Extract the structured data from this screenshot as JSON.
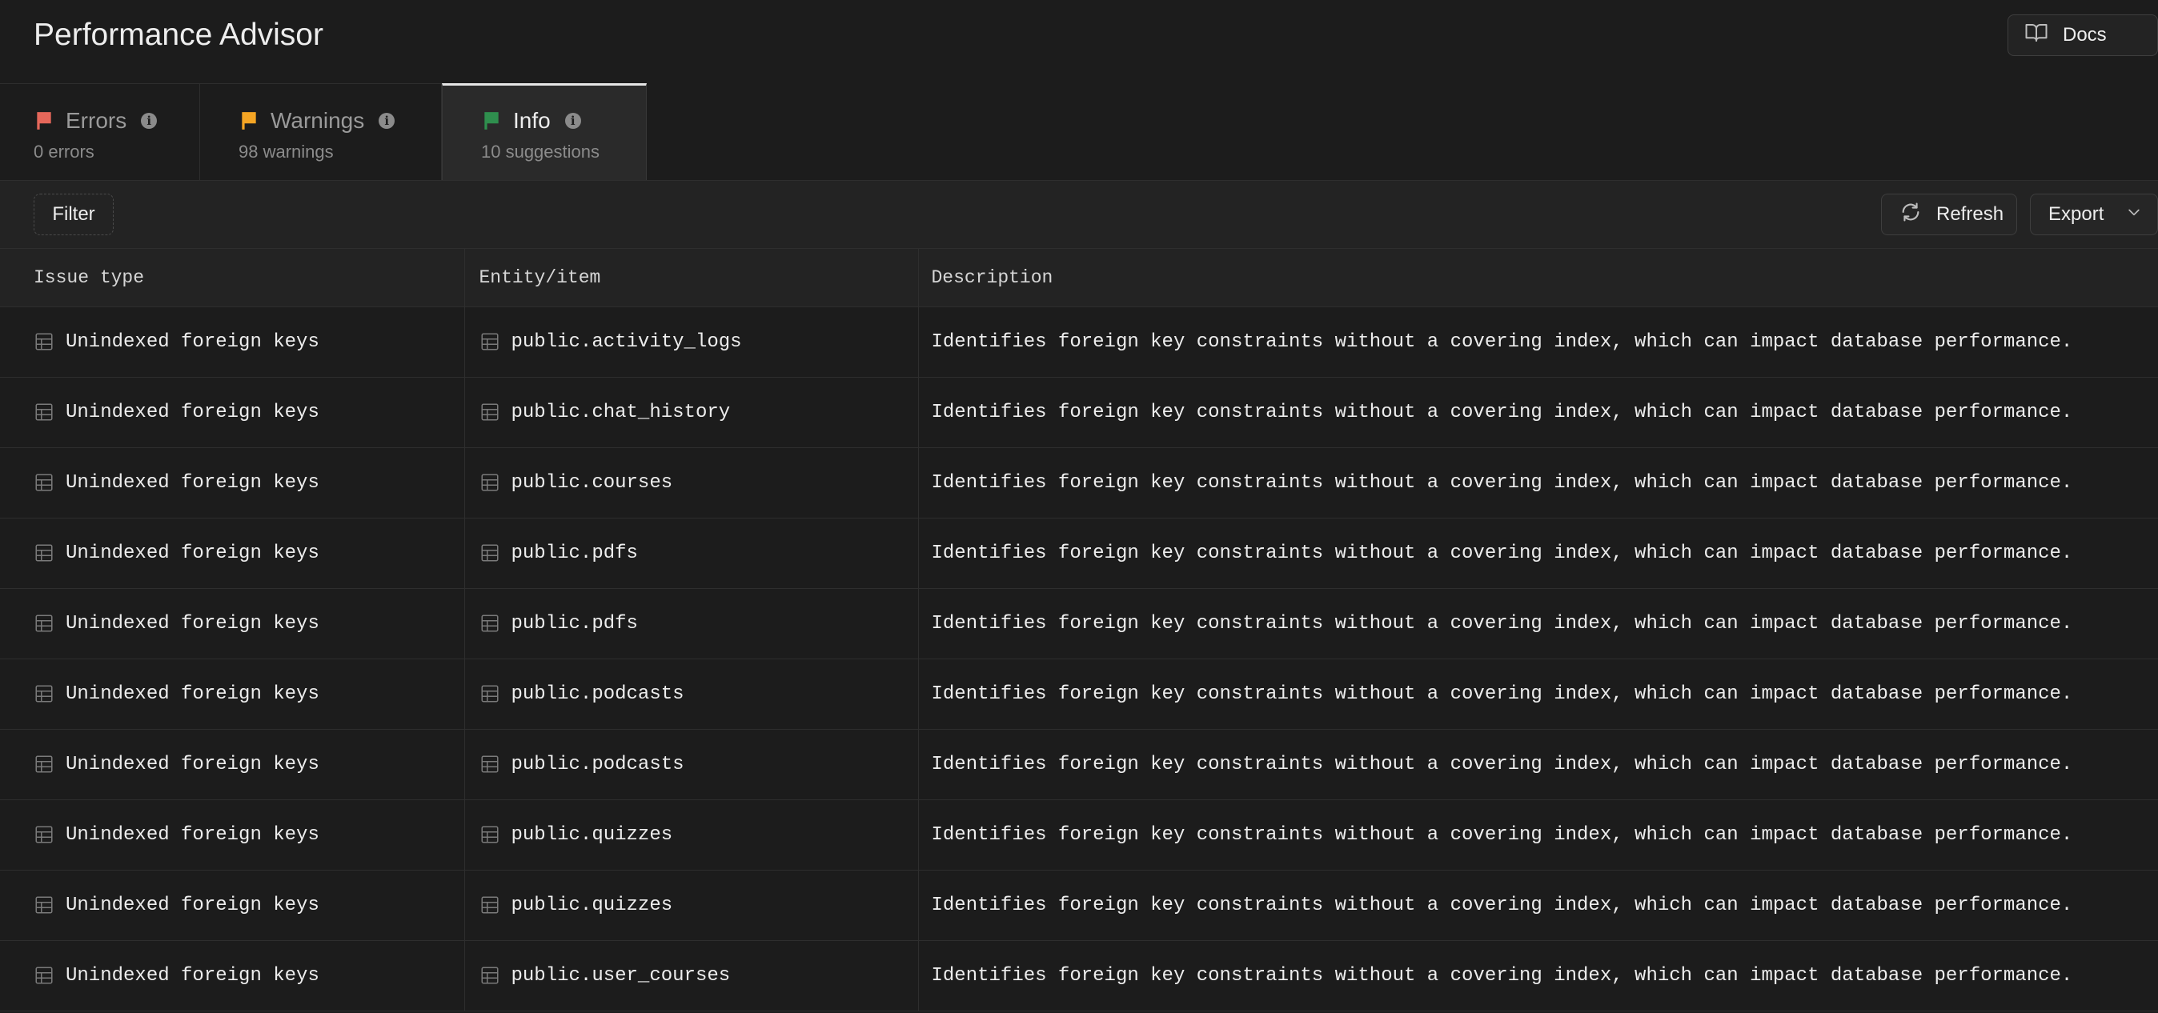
{
  "header": {
    "title": "Performance Advisor",
    "docs_label": "Docs"
  },
  "tabs": [
    {
      "label": "Errors",
      "count": "0 errors",
      "flag_color": "#e5675a"
    },
    {
      "label": "Warnings",
      "count": "98 warnings",
      "flag_color": "#f5a524"
    },
    {
      "label": "Info",
      "count": "10 suggestions",
      "flag_color": "#2f8f4e"
    }
  ],
  "toolbar": {
    "filter_label": "Filter",
    "refresh_label": "Refresh",
    "export_label": "Export"
  },
  "table": {
    "columns": [
      "Issue type",
      "Entity/item",
      "Description"
    ],
    "rows": [
      {
        "issue": "Unindexed foreign keys",
        "entity": "public.activity_logs",
        "description": "Identifies foreign key constraints without a covering index, which can impact database performance."
      },
      {
        "issue": "Unindexed foreign keys",
        "entity": "public.chat_history",
        "description": "Identifies foreign key constraints without a covering index, which can impact database performance."
      },
      {
        "issue": "Unindexed foreign keys",
        "entity": "public.courses",
        "description": "Identifies foreign key constraints without a covering index, which can impact database performance."
      },
      {
        "issue": "Unindexed foreign keys",
        "entity": "public.pdfs",
        "description": "Identifies foreign key constraints without a covering index, which can impact database performance."
      },
      {
        "issue": "Unindexed foreign keys",
        "entity": "public.pdfs",
        "description": "Identifies foreign key constraints without a covering index, which can impact database performance."
      },
      {
        "issue": "Unindexed foreign keys",
        "entity": "public.podcasts",
        "description": "Identifies foreign key constraints without a covering index, which can impact database performance."
      },
      {
        "issue": "Unindexed foreign keys",
        "entity": "public.podcasts",
        "description": "Identifies foreign key constraints without a covering index, which can impact database performance."
      },
      {
        "issue": "Unindexed foreign keys",
        "entity": "public.quizzes",
        "description": "Identifies foreign key constraints without a covering index, which can impact database performance."
      },
      {
        "issue": "Unindexed foreign keys",
        "entity": "public.quizzes",
        "description": "Identifies foreign key constraints without a covering index, which can impact database performance."
      },
      {
        "issue": "Unindexed foreign keys",
        "entity": "public.user_courses",
        "description": "Identifies foreign key constraints without a covering index, which can impact database performance."
      }
    ]
  }
}
